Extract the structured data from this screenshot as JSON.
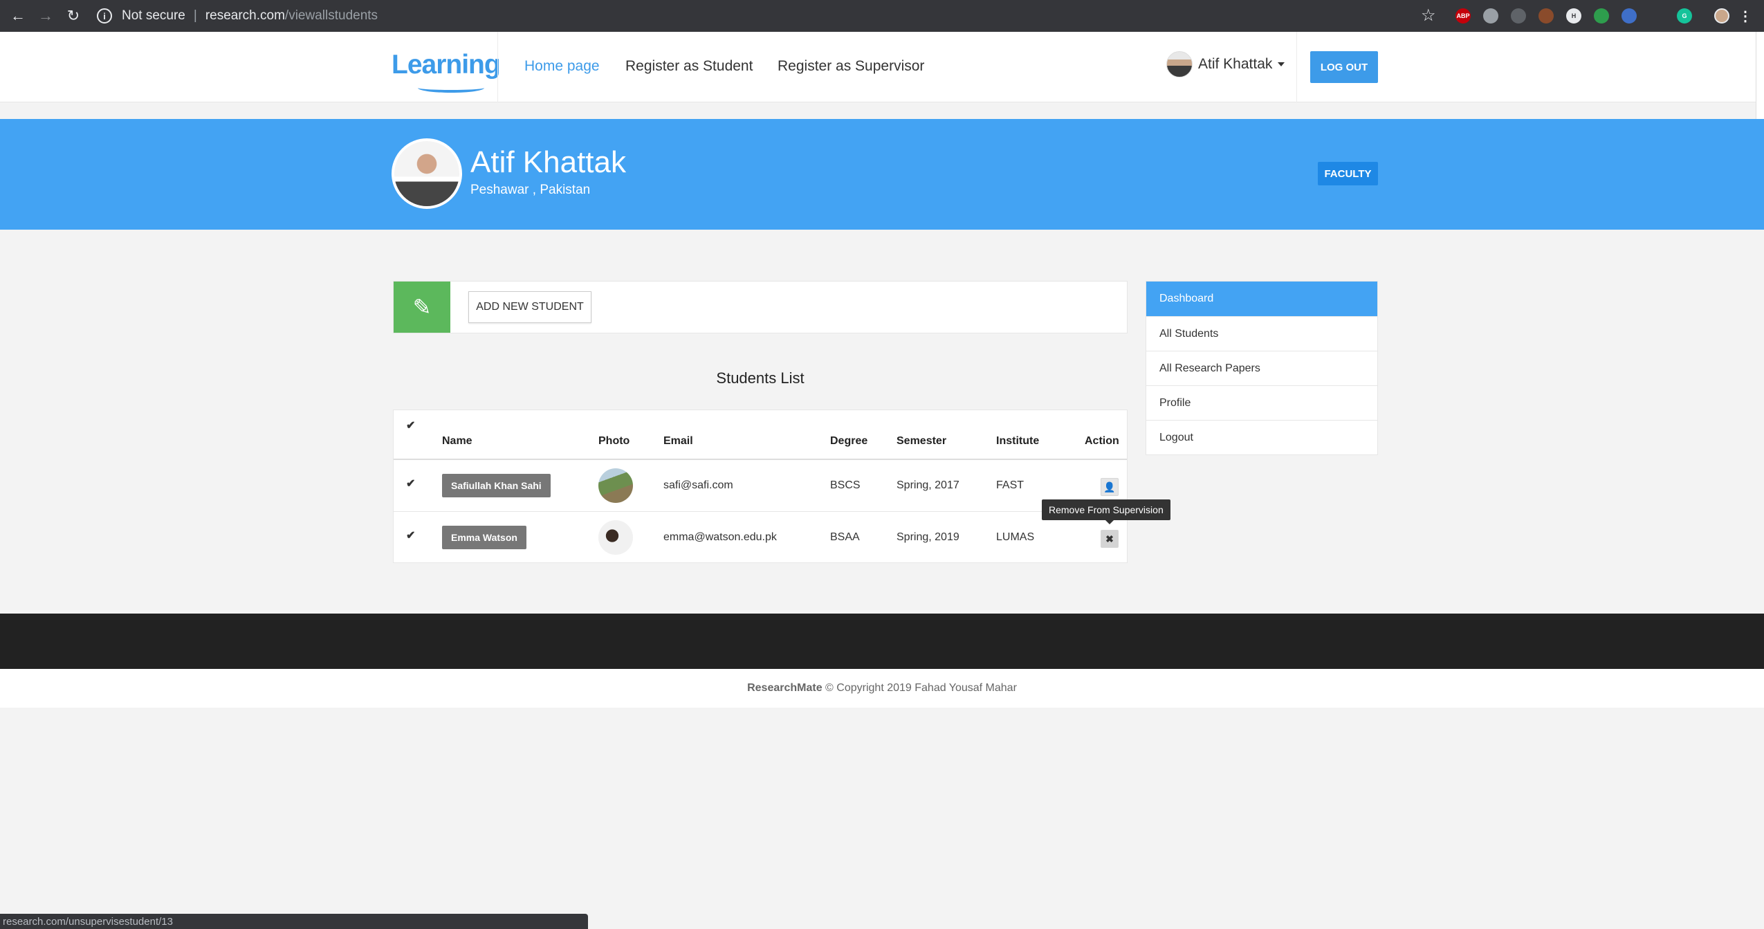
{
  "browser": {
    "security": "Not secure",
    "url_host": "research.com",
    "url_path": "/viewallstudents",
    "status_url": "research.com/unsupervisestudent/13",
    "extensions": [
      {
        "name": "abp-icon",
        "label": "ABP",
        "color": "#c4000a"
      },
      {
        "name": "extension-circle-icon",
        "label": "",
        "color": "#9aa0a6"
      },
      {
        "name": "gear-extension-icon",
        "label": "",
        "color": "#5f6368"
      },
      {
        "name": "extension-orange-icon",
        "label": "",
        "color": "#8a4b2b"
      },
      {
        "name": "extension-h-icon",
        "label": "H",
        "color": "#5f6368"
      },
      {
        "name": "extension-leaf-icon",
        "label": "",
        "color": "#2e9d4d"
      },
      {
        "name": "extension-blue-icon",
        "label": "",
        "color": "#3f6fc8"
      },
      {
        "name": "grammarly-icon",
        "label": "G",
        "color": "#15c39a"
      }
    ]
  },
  "navbar": {
    "logo": "Learning",
    "links": [
      "Home page",
      "Register as Student",
      "Register as Supervisor"
    ],
    "user_name": "Atif Khattak",
    "logout_label": "LOG OUT"
  },
  "banner": {
    "name": "Atif Khattak",
    "location": "Peshawar , Pakistan",
    "badge": "FACULTY"
  },
  "main": {
    "add_button": "ADD NEW STUDENT",
    "list_title": "Students List",
    "columns": [
      "Name",
      "Photo",
      "Email",
      "Degree",
      "Semester",
      "Institute",
      "Action"
    ],
    "students": [
      {
        "name": "Safiullah Khan Sahi",
        "email": "safi@safi.com",
        "degree": "BSCS",
        "semester": "Spring, 2017",
        "institute": "FAST",
        "action_icon": "user-icon"
      },
      {
        "name": "Emma Watson",
        "email": "emma@watson.edu.pk",
        "degree": "BSAA",
        "semester": "Spring, 2019",
        "institute": "LUMAS",
        "action_icon": "close-icon"
      }
    ],
    "tooltip": "Remove From Supervision"
  },
  "sidebar": {
    "items": [
      "Dashboard",
      "All Students",
      "All Research Papers",
      "Profile",
      "Logout"
    ],
    "active": "Dashboard"
  },
  "footer": {
    "brand": "ResearchMate",
    "copyright": "© Copyright 2019 Fahad Yousaf Mahar"
  },
  "colors": {
    "accent": "#43a3f3",
    "green": "#5cb85c",
    "dark_footer": "#222222"
  }
}
